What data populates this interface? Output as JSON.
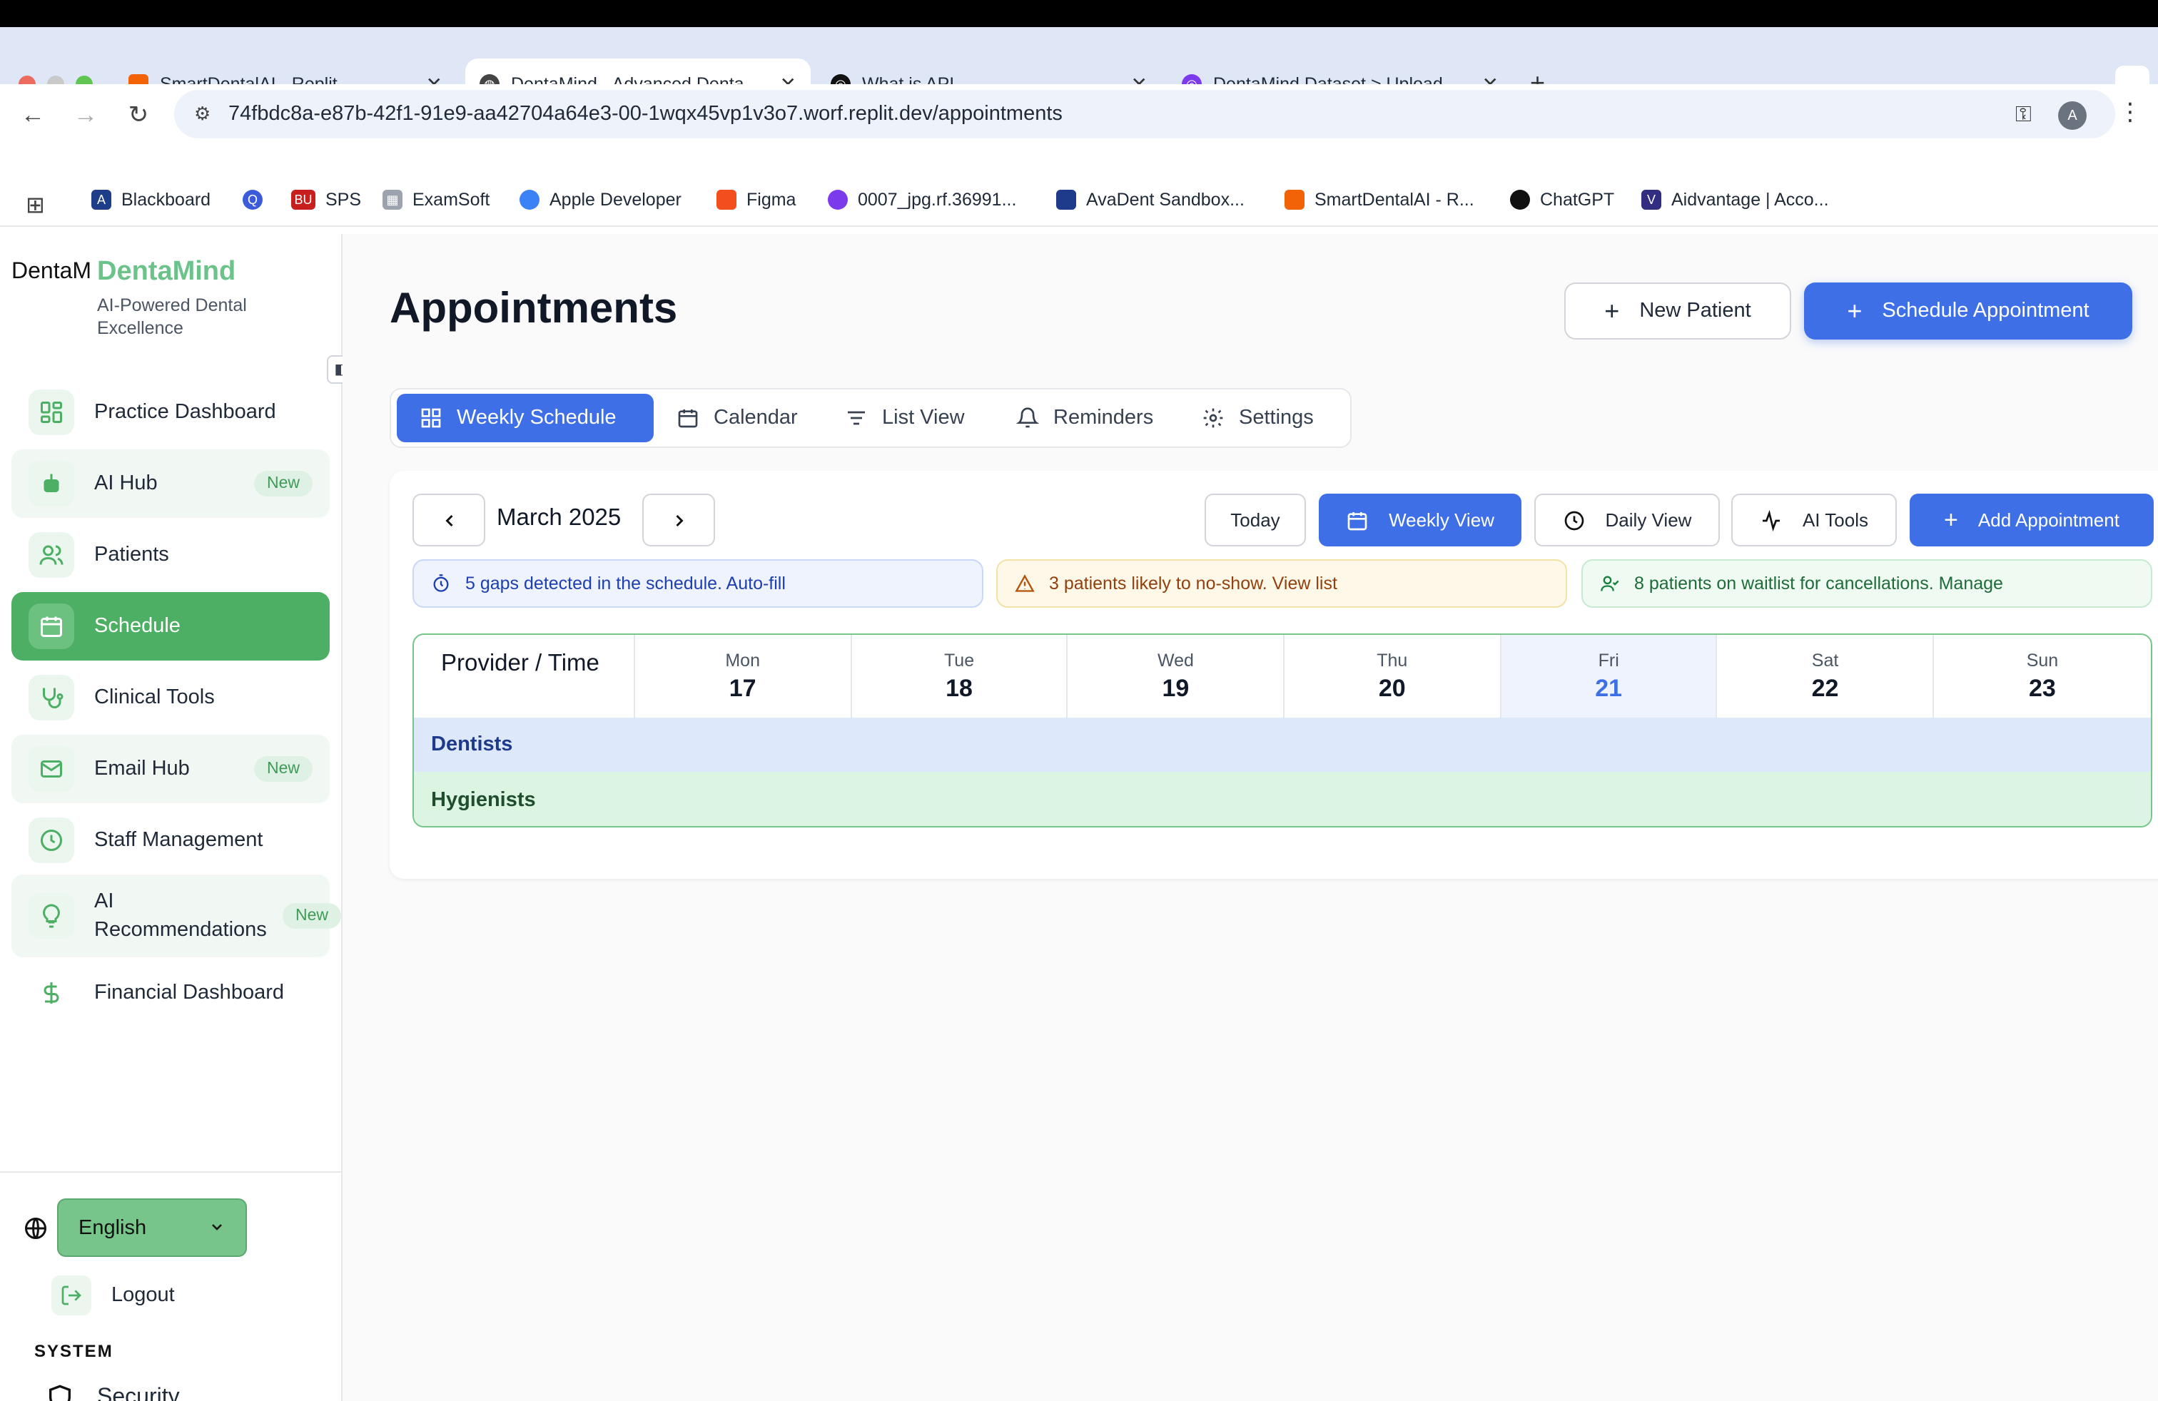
{
  "browser": {
    "tabs": [
      {
        "title": "SmartDentalAI - Replit",
        "active": false
      },
      {
        "title": "DentaMind - Advanced Denta",
        "active": true
      },
      {
        "title": "What is API",
        "active": false
      },
      {
        "title": "DentaMind Dataset > Upload",
        "active": false
      }
    ],
    "url": "74fbdc8a-e87b-42f1-91e9-aa42704a64e3-00-1wqx45vp1v3o7.worf.replit.dev/appointments",
    "profile_initial": "A",
    "bookmarks": [
      "Blackboard",
      "",
      "SPS",
      "ExamSoft",
      "Apple Developer",
      "Figma",
      "0007_jpg.rf.36991...",
      "AvaDent Sandbox...",
      "SmartDentalAI - R...",
      "ChatGPT",
      "Aidvantage | Acco..."
    ]
  },
  "sidebar": {
    "logo_alt": "DentaM",
    "brand_name": "DentaMind",
    "brand_tagline": "AI-Powered Dental Excellence",
    "items": [
      {
        "label": "Practice Dashboard",
        "badge": ""
      },
      {
        "label": "AI Hub",
        "badge": "New"
      },
      {
        "label": "Patients",
        "badge": ""
      },
      {
        "label": "Schedule",
        "badge": ""
      },
      {
        "label": "Clinical Tools",
        "badge": ""
      },
      {
        "label": "Email Hub",
        "badge": "New"
      },
      {
        "label": "Staff Management",
        "badge": ""
      },
      {
        "label": "AI Recommendations",
        "badge": "New"
      },
      {
        "label": "Financial Dashboard",
        "badge": ""
      }
    ],
    "language": "English",
    "logout_label": "Logout",
    "system_label": "SYSTEM",
    "security_label": "Security"
  },
  "main": {
    "title": "Appointments",
    "new_patient_label": "New Patient",
    "schedule_appointment_label": "Schedule Appointment",
    "view_tabs": [
      "Weekly Schedule",
      "Calendar",
      "List View",
      "Reminders",
      "Settings"
    ],
    "active_view_tab": "Weekly Schedule",
    "month_label": "March 2025",
    "today_label": "Today",
    "weekly_view_label": "Weekly View",
    "daily_view_label": "Daily View",
    "ai_tools_label": "AI Tools",
    "add_appointment_label": "Add Appointment",
    "alerts": {
      "gaps": "5 gaps detected in the schedule. Auto-fill",
      "no_show": "3 patients likely to no-show. View list",
      "waitlist": "8 patients on waitlist for cancellations. Manage"
    },
    "grid": {
      "provider_header": "Provider / Time",
      "days": [
        {
          "name": "Mon",
          "num": "17"
        },
        {
          "name": "Tue",
          "num": "18"
        },
        {
          "name": "Wed",
          "num": "19"
        },
        {
          "name": "Thu",
          "num": "20"
        },
        {
          "name": "Fri",
          "num": "21"
        },
        {
          "name": "Sat",
          "num": "22"
        },
        {
          "name": "Sun",
          "num": "23"
        }
      ],
      "today_index": 4,
      "groups": [
        "Dentists",
        "Hygienists"
      ]
    }
  },
  "colors": {
    "primary": "#3f6fe6",
    "green_active": "#4caf63",
    "brand_green": "#6cc38a"
  }
}
